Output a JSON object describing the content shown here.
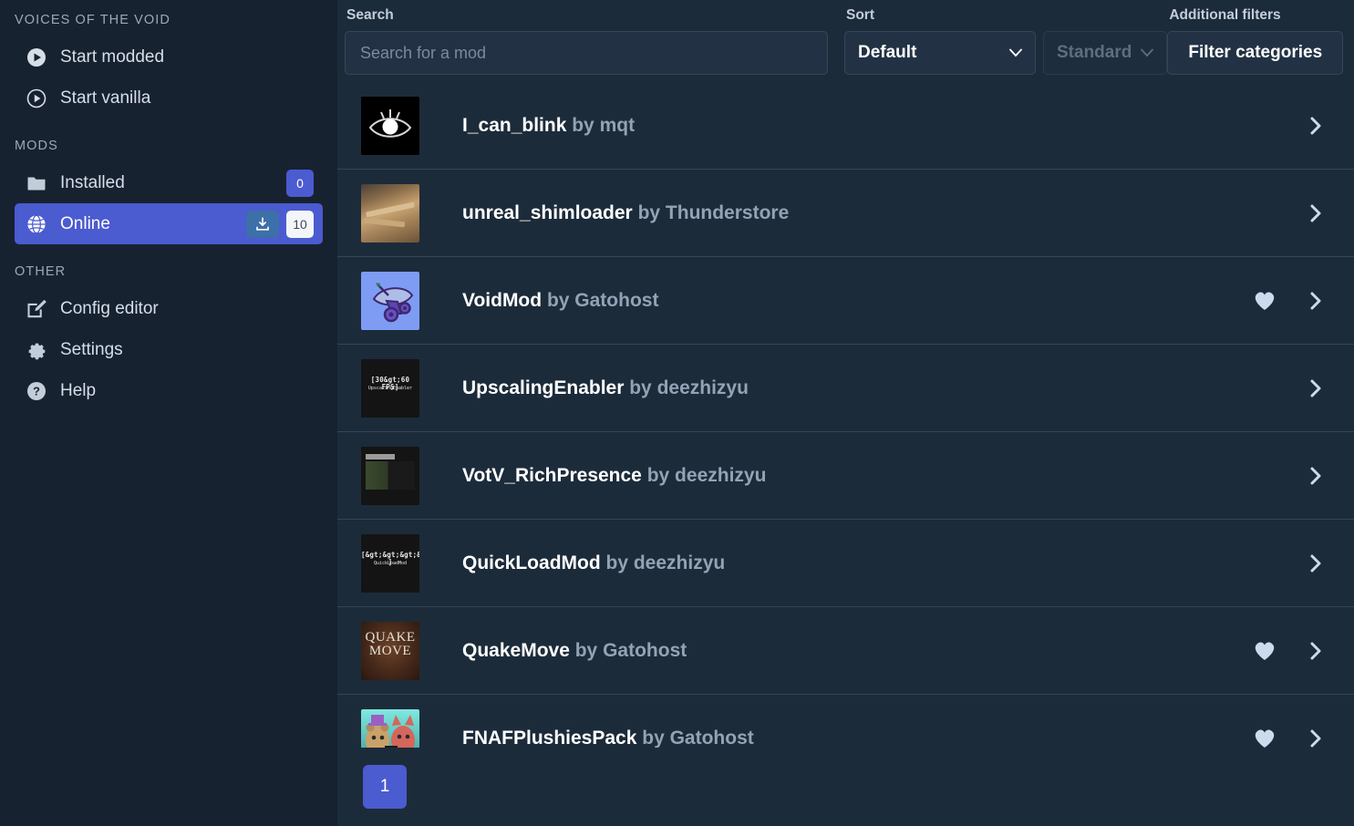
{
  "sidebar": {
    "app_title": "VOICES OF THE VOID",
    "launch_items": [
      {
        "label": "Start modded",
        "icon": "play-filled-icon"
      },
      {
        "label": "Start vanilla",
        "icon": "play-outline-icon"
      }
    ],
    "mods_header": "MODS",
    "mods_items": [
      {
        "label": "Installed",
        "icon": "folder-icon",
        "count": "0",
        "active": false,
        "has_download": false
      },
      {
        "label": "Online",
        "icon": "globe-icon",
        "count": "10",
        "active": true,
        "has_download": true
      }
    ],
    "other_header": "OTHER",
    "other_items": [
      {
        "label": "Config editor",
        "icon": "edit-square-icon"
      },
      {
        "label": "Settings",
        "icon": "gear-icon"
      },
      {
        "label": "Help",
        "icon": "question-circle-icon"
      }
    ]
  },
  "toolbar": {
    "search_label": "Search",
    "search_placeholder": "Search for a mod",
    "search_value": "",
    "sort_label": "Sort",
    "sort_value": "Default",
    "sort_direction_value": "Standard",
    "filters_label": "Additional filters",
    "filter_button_label": "Filter categories"
  },
  "mod_list": [
    {
      "name": "I_can_blink",
      "by": "by mqt",
      "thumb": "eye",
      "favorited": false
    },
    {
      "name": "unreal_shimloader",
      "by": "by Thunderstore",
      "thumb": "wood",
      "favorited": false
    },
    {
      "name": "VoidMod",
      "by": "by Gatohost",
      "thumb": "dish",
      "favorited": true
    },
    {
      "name": "UpscalingEnabler",
      "by": "by deezhizyu",
      "thumb": "upscaling",
      "favorited": false
    },
    {
      "name": "VotV_RichPresence",
      "by": "by deezhizyu",
      "thumb": "richpresence",
      "favorited": false
    },
    {
      "name": "QuickLoadMod",
      "by": "by deezhizyu",
      "thumb": "quickload",
      "favorited": false
    },
    {
      "name": "QuakeMove",
      "by": "by Gatohost",
      "thumb": "quake",
      "favorited": true
    },
    {
      "name": "FNAFPlushiesPack",
      "by": "by Gatohost",
      "thumb": "fnaf",
      "favorited": true
    }
  ],
  "thumb_text": {
    "upscaling_line1": "[30&gt;60 FPS]",
    "upscaling_line2": "UpscalingEnabler",
    "quickload_line1": "[&gt;&gt;&gt;&gt;  ]",
    "quickload_line2": "QuickLoadMod",
    "quake_line1": "QUAKE",
    "quake_line2": "MOVE"
  },
  "pagination": {
    "current_page": "1"
  },
  "colors": {
    "accent": "#4b5bd0",
    "background": "#1c2b3a",
    "sidebar_background": "#172231",
    "divider": "#35465a",
    "text_primary": "#ffffff",
    "text_muted": "#93a3b5",
    "icon_light": "#ccdcee"
  }
}
